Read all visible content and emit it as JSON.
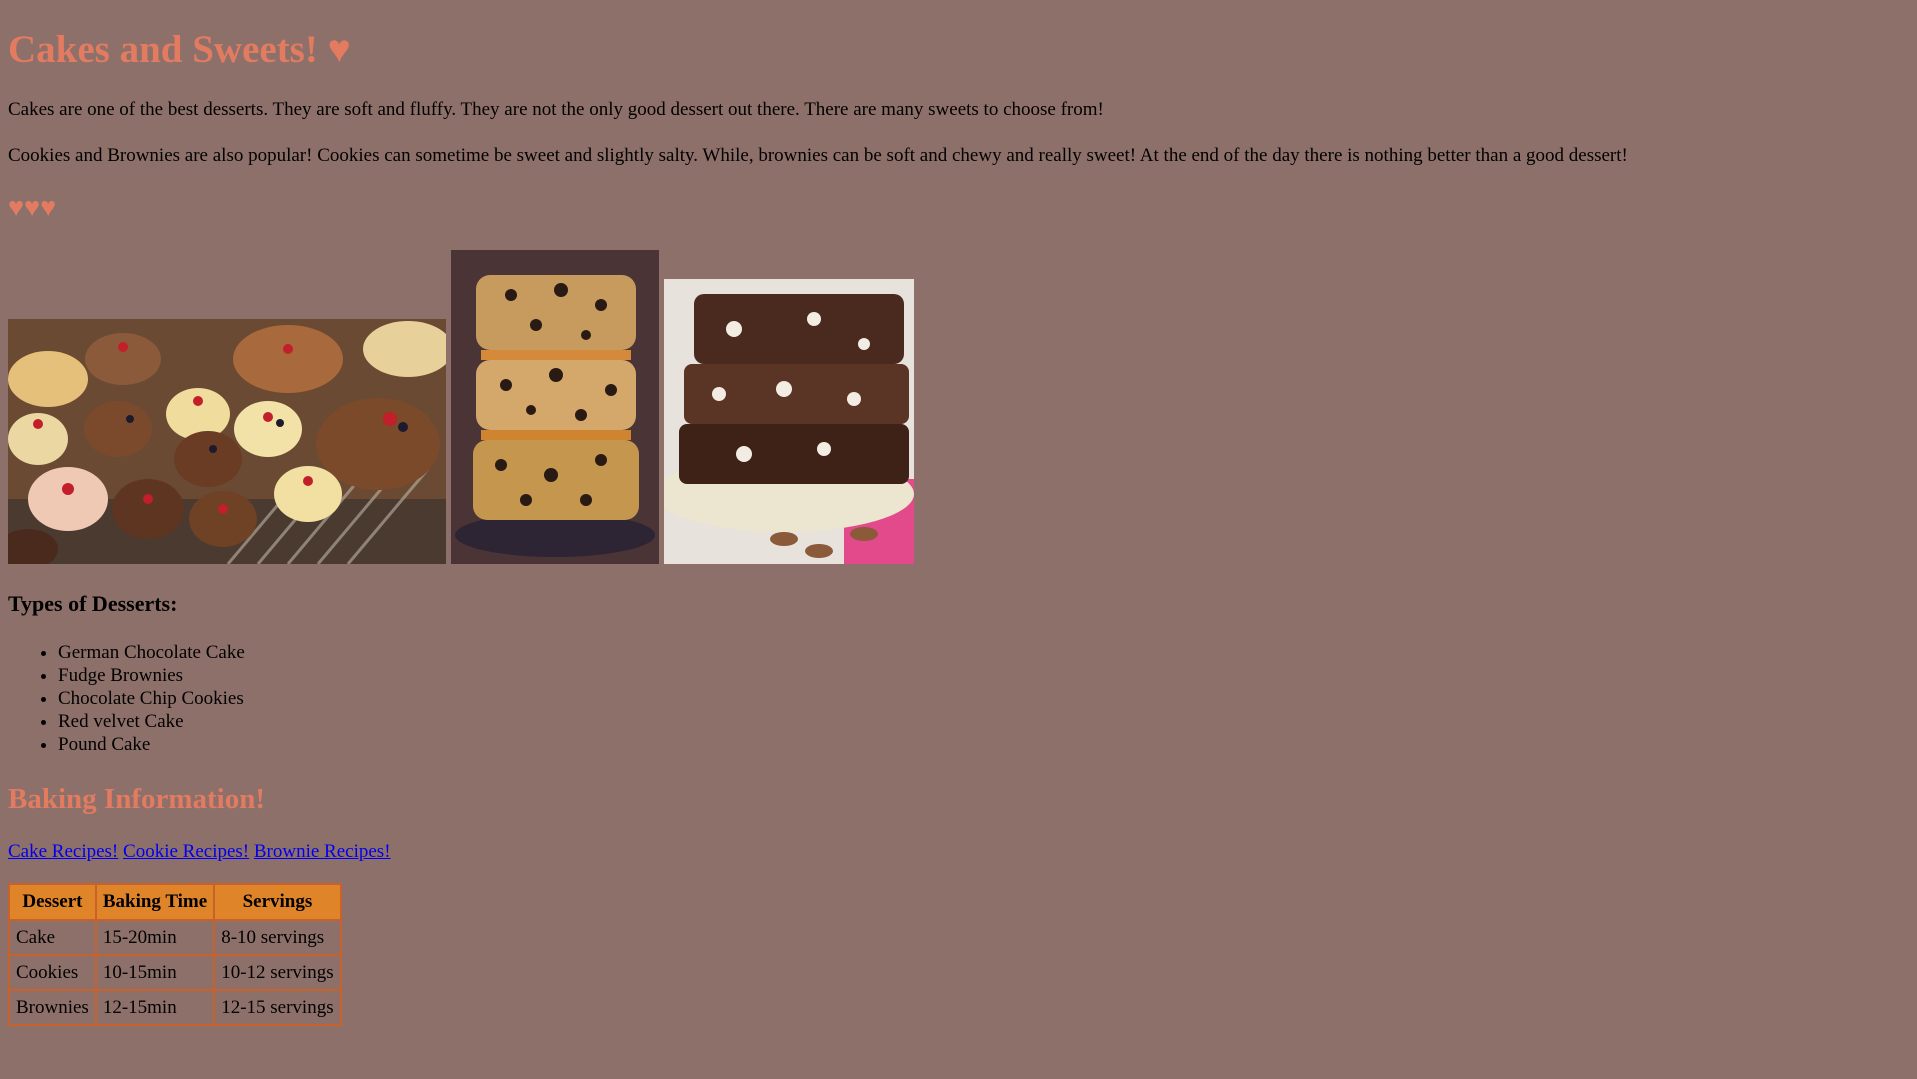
{
  "page": {
    "title": "Cakes and Sweets! ♥",
    "intro_paragraph": "Cakes are one of the best desserts. They are soft and fluffy. They are not the only good dessert out there. There are many sweets to choose from!",
    "second_paragraph": "Cookies and Brownies are also popular! Cookies can sometime be sweet and slightly salty. While, brownies can be soft and chewy and really sweet! At the end of the day there is nothing better than a good dessert!",
    "hearts": "♥♥♥"
  },
  "images": [
    {
      "name": "cakes-photo",
      "subject": "assorted cakes and tarts in a display case"
    },
    {
      "name": "cookie-bars-photo",
      "subject": "stacked chocolate chip cookie bars"
    },
    {
      "name": "brownies-photo",
      "subject": "stacked white chocolate brownies on a plate"
    }
  ],
  "desserts_section": {
    "heading": "Types of Desserts:",
    "items": [
      "German Chocolate Cake",
      "Fudge Brownies",
      "Chocolate Chip Cookies",
      "Red velvet Cake",
      "Pound Cake"
    ]
  },
  "baking_section": {
    "heading": "Baking Information!",
    "links": [
      "Cake Recipes!",
      "Cookie Recipes!",
      "Brownie Recipes!"
    ],
    "table": {
      "headers": [
        "Dessert",
        "Baking Time",
        "Servings"
      ],
      "rows": [
        [
          "Cake",
          "15-20min",
          "8-10 servings"
        ],
        [
          "Cookies",
          "10-15min",
          "10-12 servings"
        ],
        [
          "Brownies",
          "12-15min",
          "12-15 servings"
        ]
      ]
    }
  },
  "colors": {
    "background": "#8e706a",
    "heading_accent": "#e27b5f",
    "table_header": "#e0842a",
    "table_border": "#c9622a",
    "link": "#0000ee"
  }
}
